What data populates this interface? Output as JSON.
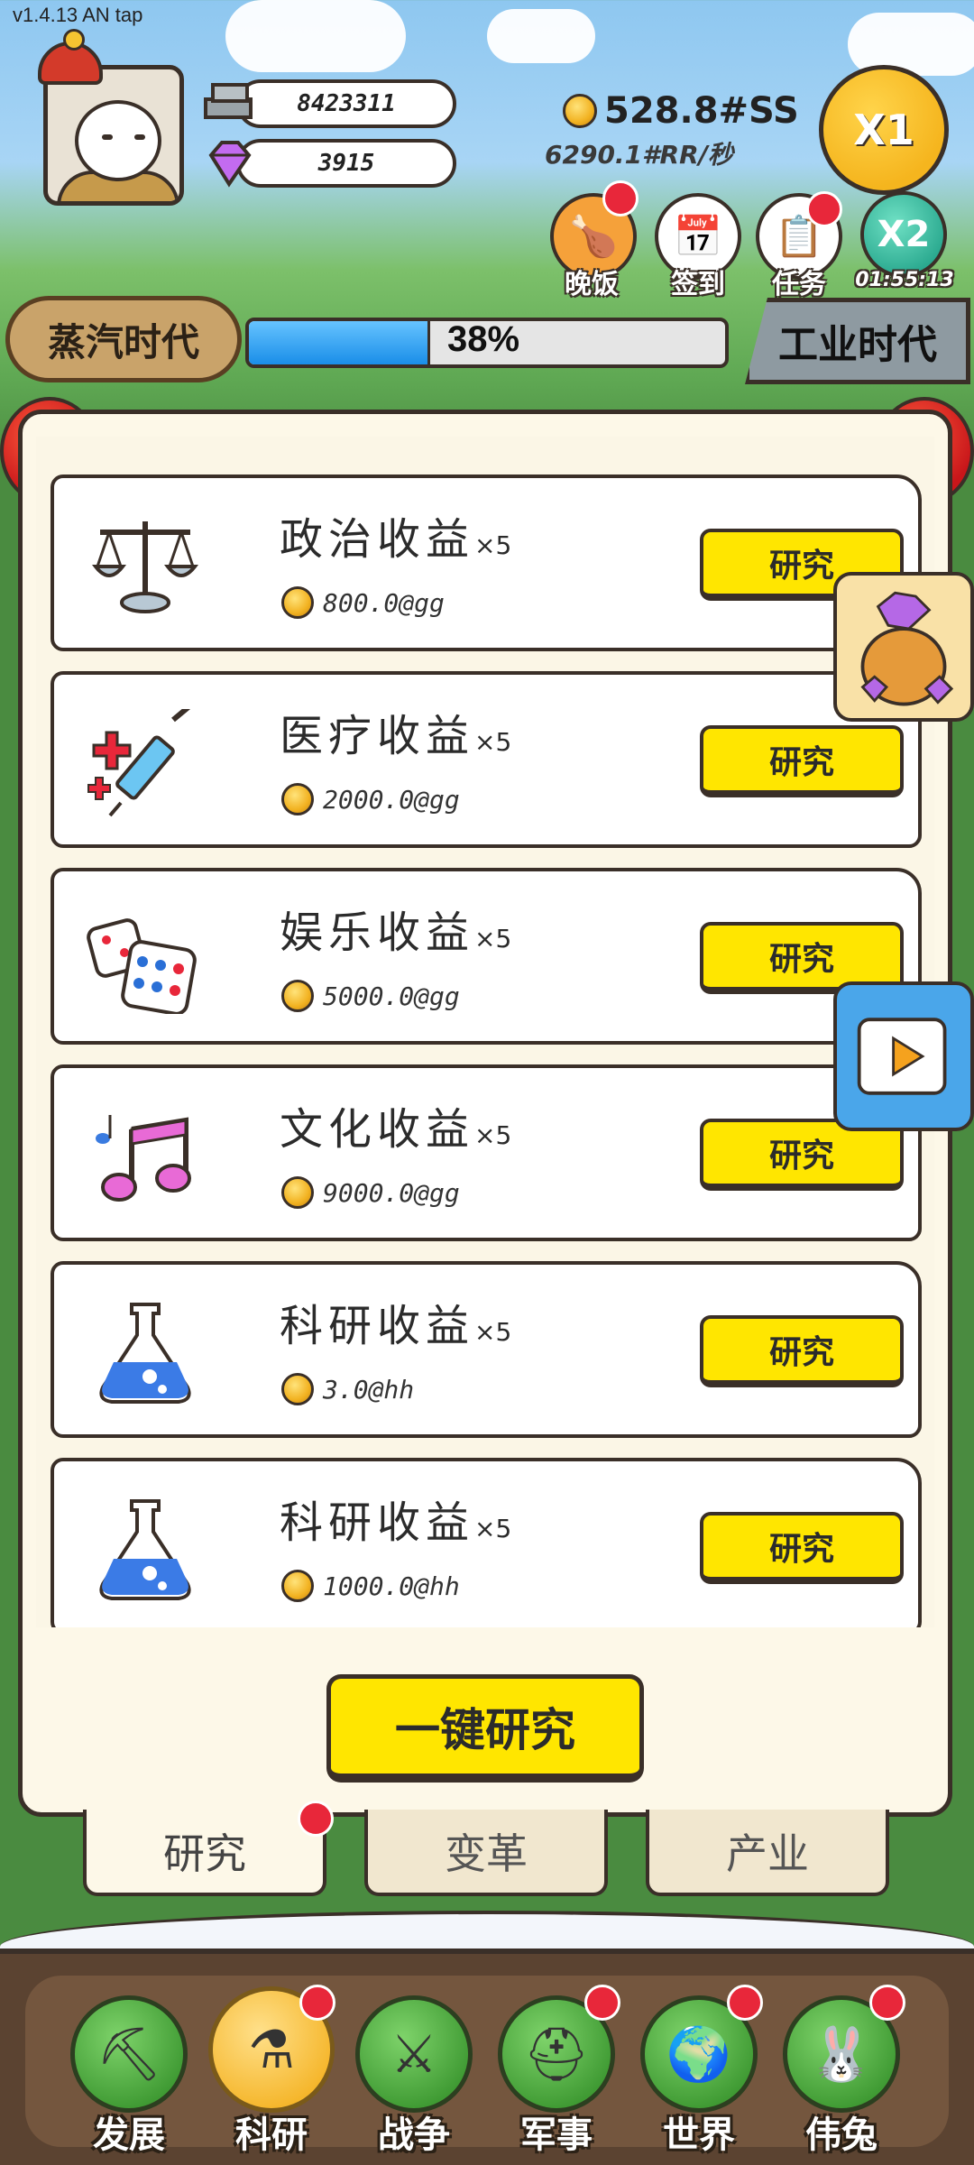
{
  "version": "v1.4.13 AN tap",
  "resources": {
    "silver": "8423311",
    "gems": "3915",
    "gold": "528.8#SS",
    "rate": "6290.1#RR/秒"
  },
  "speed_button": "X1",
  "quick_actions": [
    {
      "label": "晚饭",
      "icon": "chicken-leg-icon"
    },
    {
      "label": "签到",
      "icon": "calendar-icon"
    },
    {
      "label": "任务",
      "icon": "clipboard-icon"
    },
    {
      "label": "01:55:13",
      "badge": "X2",
      "icon": "double-speed-icon"
    }
  ],
  "era": {
    "current": "蒸汽时代",
    "next": "工业时代",
    "progress_text": "38%",
    "progress": 0.38
  },
  "research_cards": [
    {
      "title": "政治收益",
      "multiplier": "×5",
      "cost": "800.0@gg",
      "button": "研究",
      "icon": "scale-icon"
    },
    {
      "title": "医疗收益",
      "multiplier": "×5",
      "cost": "2000.0@gg",
      "button": "研究",
      "icon": "syringe-icon"
    },
    {
      "title": "娱乐收益",
      "multiplier": "×5",
      "cost": "5000.0@gg",
      "button": "研究",
      "icon": "dice-icon"
    },
    {
      "title": "文化收益",
      "multiplier": "×5",
      "cost": "9000.0@gg",
      "button": "研究",
      "icon": "music-note-icon"
    },
    {
      "title": "科研收益",
      "multiplier": "×5",
      "cost": "3.0@hh",
      "button": "研究",
      "icon": "flask-icon"
    },
    {
      "title": "科研收益",
      "multiplier": "×5",
      "cost": "1000.0@hh",
      "button": "研究",
      "icon": "flask-icon"
    }
  ],
  "one_click_button": "一键研究",
  "sub_tabs": [
    "研究",
    "变革",
    "产业"
  ],
  "bottom_nav": [
    {
      "label": "发展",
      "icon": "axe-icon"
    },
    {
      "label": "科研",
      "icon": "flask-icon"
    },
    {
      "label": "战争",
      "icon": "crossed-swords-icon"
    },
    {
      "label": "军事",
      "icon": "helmet-icon"
    },
    {
      "label": "世界",
      "icon": "globe-icon"
    },
    {
      "label": "伟兔",
      "icon": "rabbit-portrait-icon"
    }
  ],
  "colors": {
    "accent_yellow": "#ffe600",
    "progress_blue": "#1a8ee8",
    "badge_red": "#e8273a",
    "nav_green": "#3f9a33"
  }
}
